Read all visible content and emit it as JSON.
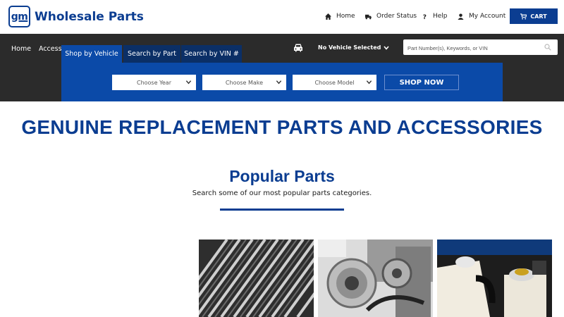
{
  "header": {
    "logo_mark": "gm",
    "brand": "Wholesale Parts",
    "links": {
      "home": "Home",
      "order_status": "Order Status",
      "help": "Help",
      "account": "My Account"
    },
    "cart_label": "CART",
    "icons": [
      "home-icon",
      "truck-icon",
      "question-icon",
      "user-icon",
      "cart-icon"
    ]
  },
  "nav": {
    "home": "Home",
    "accessories": "Accesso",
    "vehicle_selected": "No Vehicle Selected",
    "search_placeholder": "Part Number(s), Keywords, or VIN"
  },
  "vehicle_search": {
    "tabs": [
      "Shop by Vehicle",
      "Search by Part",
      "Search by VIN #"
    ],
    "active_tab": "Shop by Vehicle",
    "year": "Choose Year",
    "make": "Choose Make",
    "model": "Choose Model",
    "shop_button": "SHOP NOW"
  },
  "main": {
    "headline": "GENUINE REPLACEMENT PARTS AND ACCESSORIES",
    "popular_title": "Popular Parts",
    "popular_subtitle": "Search some of our most popular parts categories."
  },
  "colors": {
    "brand_blue": "#0b3d91",
    "panel_blue": "#0b4aa8",
    "tab_dark": "#0b2f66",
    "nav_dark": "#2b2b2b"
  }
}
